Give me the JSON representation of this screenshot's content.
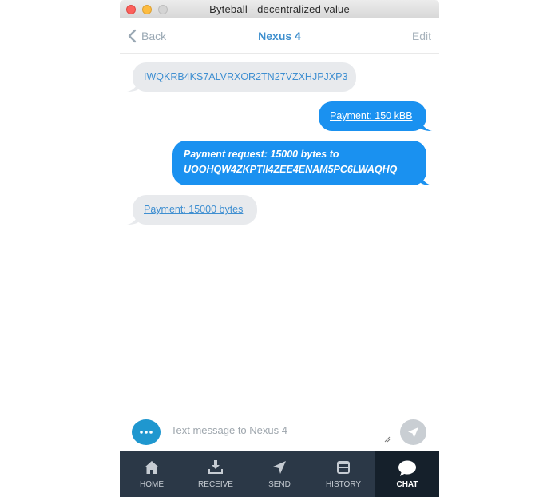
{
  "window": {
    "title": "Byteball - decentralized value"
  },
  "nav": {
    "back_label": "Back",
    "title": "Nexus 4",
    "edit_label": "Edit"
  },
  "messages": [
    {
      "direction": "incoming",
      "text": "IWQKRB4KS7ALVRXOR2TN27VZXHJPJXP3"
    },
    {
      "direction": "outgoing",
      "text": "Payment: 150 kBB"
    },
    {
      "direction": "outgoing",
      "line1": "Payment request: 15000 bytes to",
      "line2": "UOOHQW4ZKPTII4ZEE4ENAM5PC6LWAQHQ"
    },
    {
      "direction": "incoming",
      "text": "Payment: 15000 bytes"
    }
  ],
  "composer": {
    "placeholder": "Text message to Nexus 4",
    "value": ""
  },
  "tabs": [
    {
      "label": "HOME",
      "icon": "home-icon",
      "active": false
    },
    {
      "label": "RECEIVE",
      "icon": "download-icon",
      "active": false
    },
    {
      "label": "SEND",
      "icon": "send-icon",
      "active": false
    },
    {
      "label": "HISTORY",
      "icon": "history-icon",
      "active": false
    },
    {
      "label": "CHAT",
      "icon": "chat-icon",
      "active": true
    }
  ],
  "colors": {
    "accent": "#1a91f0",
    "incoming_bubble": "#e8eaed",
    "tabbar": "#2b3847",
    "tab_active": "#15202b"
  }
}
